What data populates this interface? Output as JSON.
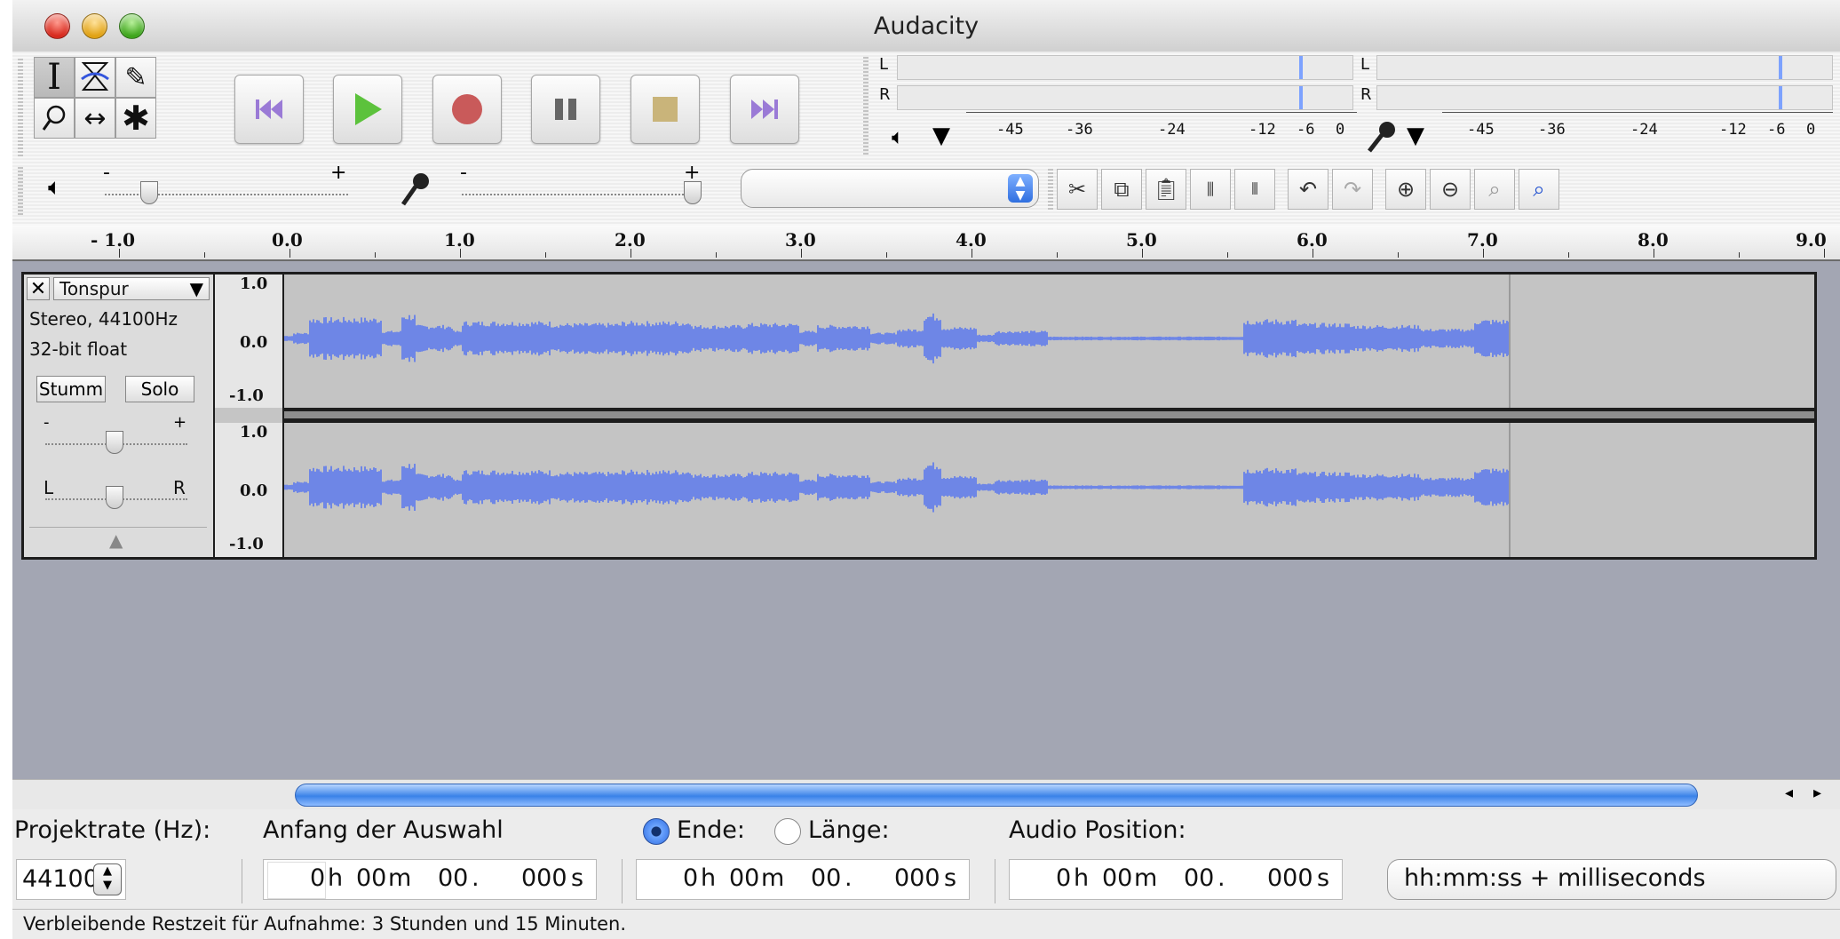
{
  "window": {
    "title": "Audacity"
  },
  "tools": {
    "selection_icon": "ibeam-icon",
    "envelope_icon": "envelope-icon",
    "draw_icon": "pencil-icon",
    "zoom_icon": "zoom-icon",
    "timeshift_icon": "timeshift-icon",
    "multi_icon": "multitool-icon"
  },
  "meters": {
    "play": {
      "l": "L",
      "r": "R",
      "scale": [
        "-45",
        "-36",
        "-24",
        "-12",
        "-6",
        "0"
      ]
    },
    "record": {
      "l": "L",
      "r": "R",
      "scale": [
        "-45",
        "-36",
        "-24",
        "-12",
        "-6",
        "0"
      ]
    }
  },
  "mixer": {
    "out_minus": "-",
    "out_plus": "+",
    "in_minus": "-",
    "in_plus": "+",
    "input_source": ""
  },
  "ruler": {
    "labels": [
      "- 1.0",
      "0.0",
      "1.0",
      "2.0",
      "3.0",
      "4.0",
      "5.0",
      "6.0",
      "7.0",
      "8.0",
      "9.0"
    ]
  },
  "track": {
    "name": "Tonspur",
    "format": "Stereo, 44100Hz",
    "bitdepth": "32-bit float",
    "mute_label": "Stumm",
    "solo_label": "Solo",
    "gain_minus": "-",
    "gain_plus": "+",
    "pan_left": "L",
    "pan_right": "R",
    "scale_top": "1.0",
    "scale_mid": "0.0",
    "scale_bottom": "-1.0"
  },
  "selection": {
    "project_rate_label": "Projektrate (Hz):",
    "project_rate_value": "44100",
    "start_label": "Anfang der Auswahl",
    "end_label": "Ende:",
    "length_label": "Länge:",
    "audio_pos_label": "Audio Position:",
    "start": {
      "h": "0",
      "m": "00",
      "s": "00",
      "ms": "000"
    },
    "end": {
      "h": "0",
      "m": "00",
      "s": "00",
      "ms": "000"
    },
    "pos": {
      "h": "0",
      "m": "00",
      "s": "00",
      "ms": "000"
    },
    "unit_h": "h",
    "unit_m": "m",
    "unit_dot": ".",
    "unit_s": "s",
    "format_value": "hh:mm:ss + milliseconds"
  },
  "status": {
    "text": "Verbleibende Restzeit für Aufnahme: 3 Stunden und 15 Minuten."
  },
  "colors": {
    "waveform": "#6e86e6",
    "selected_tool": "#c4c4c4",
    "track_bg": "#a3a6b3"
  }
}
